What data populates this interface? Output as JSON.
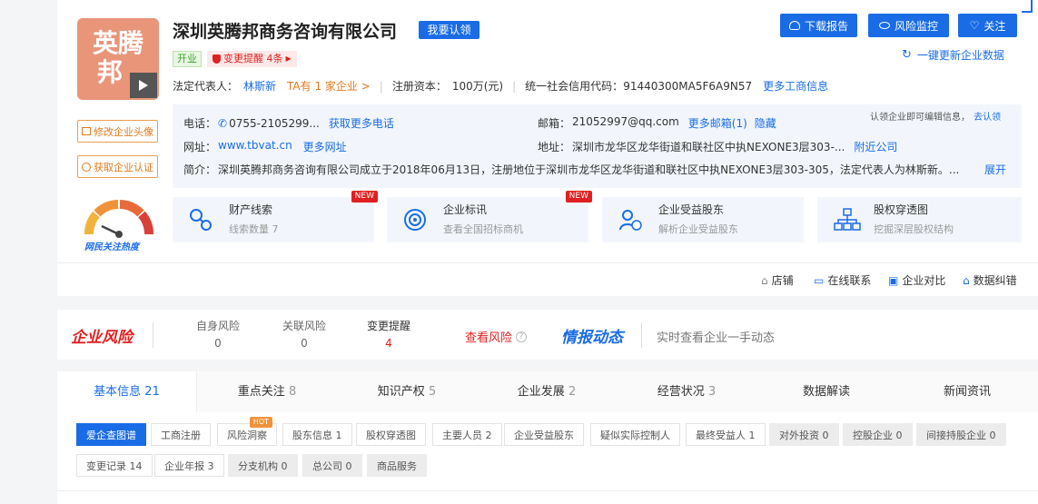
{
  "company": {
    "logo_text": "英腾\n邦",
    "name": "深圳英腾邦商务咨询有限公司",
    "claim_button": "我要认领",
    "status_tag": "开业",
    "change_tag": "变更提醒 4条",
    "legal_rep_label": "法定代表人：",
    "legal_rep": "林斯新",
    "ta_link": "TA有 1 家企业 >",
    "capital_label": "注册资本：",
    "capital": "100万(元)",
    "credit_code_label": "统一社会信用代码：",
    "credit_code": "91440300MA5F6A9N57",
    "more_business": "更多工商信息"
  },
  "actions": {
    "download": "下载报告",
    "monitor": "风险监控",
    "follow": "关注",
    "refresh": "一键更新企业数据"
  },
  "side": {
    "edit_avatar": "修改企业头像",
    "get_cert": "获取企业认证",
    "heat_label": "网民关注热度"
  },
  "contact": {
    "claim_note": "认领企业即可编辑信息，",
    "claim_link": "去认领",
    "phone_label": "电话：",
    "phone": "0755-2105299...",
    "phone_more": "获取更多电话",
    "email_label": "邮箱：",
    "email": "21052997@qq.com",
    "email_more": "更多邮箱(1)",
    "email_hide": "隐藏",
    "website_label": "网址：",
    "website": "www.tbvat.cn",
    "website_more": "更多网址",
    "address_label": "地址：",
    "address": "深圳市龙华区龙华街道和联社区中执NEXONE3层303-...",
    "address_near": "附近公司",
    "intro_label": "简介：",
    "intro": "深圳英腾邦商务咨询有限公司成立于2018年06月13日，注册地位于深圳市龙华区龙华街道和联社区中执NEXONE3层303-305，法定代表人为林斯新。...",
    "intro_expand": "展开"
  },
  "features": [
    {
      "title": "财产线索",
      "sub": "线索数量 7",
      "badge": "NEW"
    },
    {
      "title": "企业标讯",
      "sub": "查看全国招标商机",
      "badge": "NEW"
    },
    {
      "title": "企业受益股东",
      "sub": "解析企业受益股东",
      "badge": ""
    },
    {
      "title": "股权穿透图",
      "sub": "挖掘深层股权结构",
      "badge": ""
    }
  ],
  "bottom_links": {
    "shop": "店铺",
    "online": "在线联系",
    "compare": "企业对比",
    "correct": "数据纠错"
  },
  "risk": {
    "title": "企业风险",
    "self_label": "自身风险",
    "self_value": "0",
    "related_label": "关联风险",
    "related_value": "0",
    "change_label": "变更提醒",
    "change_value": "4",
    "view": "查看风险",
    "news_title": "情报动态",
    "news_text": "实时查看企业一手动态"
  },
  "tabs": [
    {
      "label": "基本信息",
      "count": "21"
    },
    {
      "label": "重点关注",
      "count": "8"
    },
    {
      "label": "知识产权",
      "count": "5"
    },
    {
      "label": "企业发展",
      "count": "2"
    },
    {
      "label": "经营状况",
      "count": "3"
    },
    {
      "label": "数据解读",
      "count": ""
    },
    {
      "label": "新闻资讯",
      "count": ""
    }
  ],
  "chips": {
    "c1": "爱企查图谱",
    "c2": "工商注册",
    "c3": "风险洞察",
    "c3_badge": "HOT",
    "c4": "股东信息 1",
    "c5": "股权穿透图",
    "c6": "主要人员 2",
    "c7": "企业受益股东",
    "c8": "疑似实际控制人",
    "c9": "最终受益人 1",
    "c10": "对外投资 0",
    "c11": "控股企业 0",
    "c12": "间接持股企业 0",
    "c13": "变更记录 14",
    "c14": "企业年报 3",
    "c15": "分支机构 0",
    "c16": "总公司 0",
    "c17": "商品服务"
  },
  "colors": {
    "accent": "#1a6ce6",
    "risk_red": "#e02020",
    "logo_bg": "#e8957a",
    "orange": "#e07a1e"
  }
}
